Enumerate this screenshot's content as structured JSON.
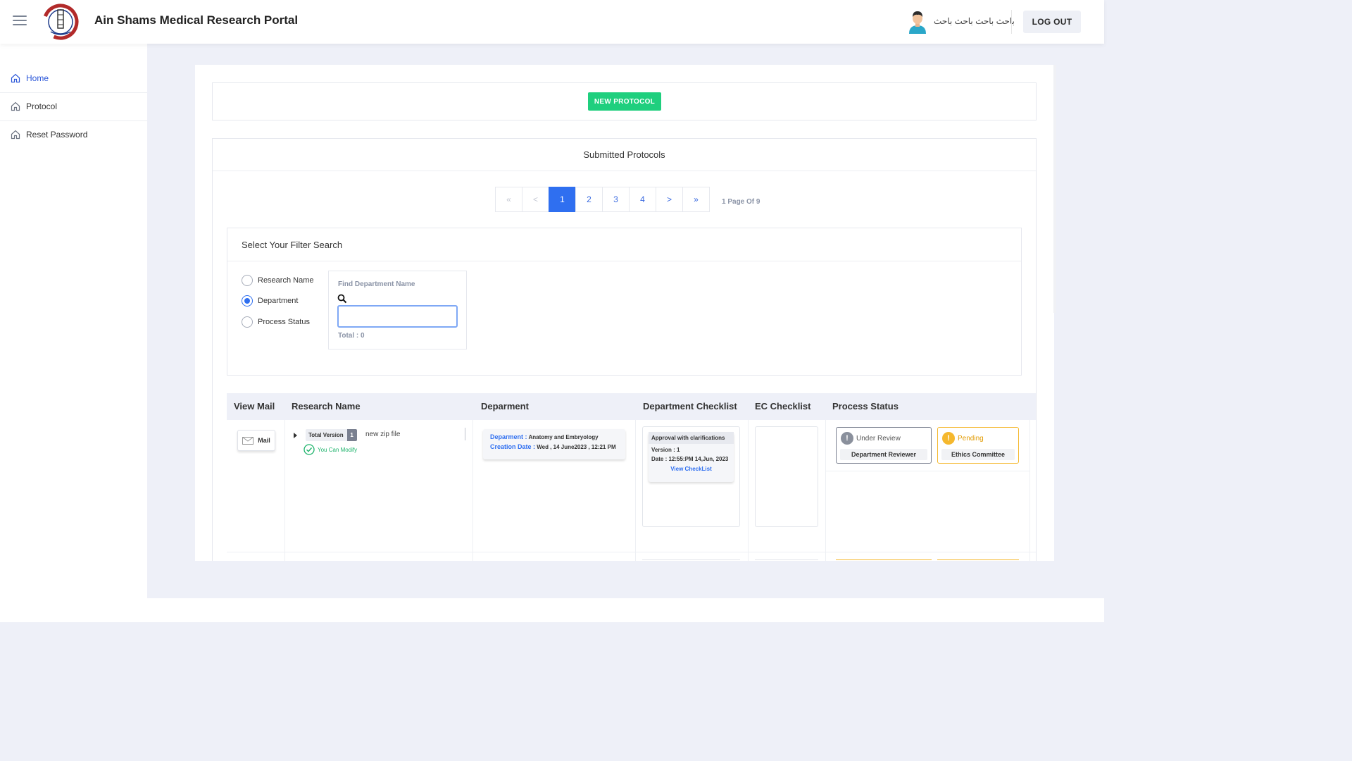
{
  "header": {
    "app_title": "Ain Shams Medical Research Portal",
    "user_name": "باحث باحث باحث باحث",
    "logout_label": "LOG OUT"
  },
  "sidebar": {
    "items": [
      {
        "label": "Home",
        "icon": "home-icon",
        "active": true
      },
      {
        "label": "Protocol",
        "icon": "home-icon",
        "active": false
      },
      {
        "label": "Reset Password",
        "icon": "home-icon",
        "active": false
      }
    ]
  },
  "main": {
    "new_protocol_label": "NEW PROTOCOL",
    "submitted_title": "Submitted Protocols",
    "pagination": {
      "first": "«",
      "prev": "<",
      "pages": [
        "1",
        "2",
        "3",
        "4"
      ],
      "current": "1",
      "next": ">",
      "last": "»",
      "info": "1 Page Of 9"
    },
    "filter": {
      "title": "Select Your Filter Search",
      "options": [
        "Research Name",
        "Department",
        "Process Status"
      ],
      "selected": "Department",
      "find_label": "Find Department Name",
      "find_value": "",
      "total": "Total : 0"
    },
    "table": {
      "headers": [
        "View Mail",
        "Research Name",
        "Deparment",
        "Department Checklist",
        "EC Checklist",
        "Process Status"
      ],
      "rows": [
        {
          "mail_label": "Mail",
          "total_version_label": "Total Version",
          "total_version_count": "1",
          "research_name": "new zip file",
          "modify_text": "You Can Modify",
          "department_key": "Deparment :",
          "department_value": "Anatomy and Embryology",
          "creation_key": "Creation Date :",
          "creation_value": "Wed , 14 June2023 , 12:21 PM",
          "checklist_status": "Approval with clarifications",
          "checklist_version": "Version : 1",
          "checklist_date": "Date : 12:55:PM 14,Jun, 2023",
          "checklist_link": "View CheckList",
          "process": [
            {
              "status": "Under Review",
              "by": "Department Reviewer",
              "color": "#7a8090"
            },
            {
              "status": "Pending",
              "by": "Ethics Committee",
              "color": "#f5b82e"
            }
          ]
        }
      ]
    }
  },
  "colors": {
    "accent": "#2f6ff0",
    "new_protocol": "#1fcf7e",
    "pending": "#f5b82e",
    "modify": "#1bb26a"
  }
}
